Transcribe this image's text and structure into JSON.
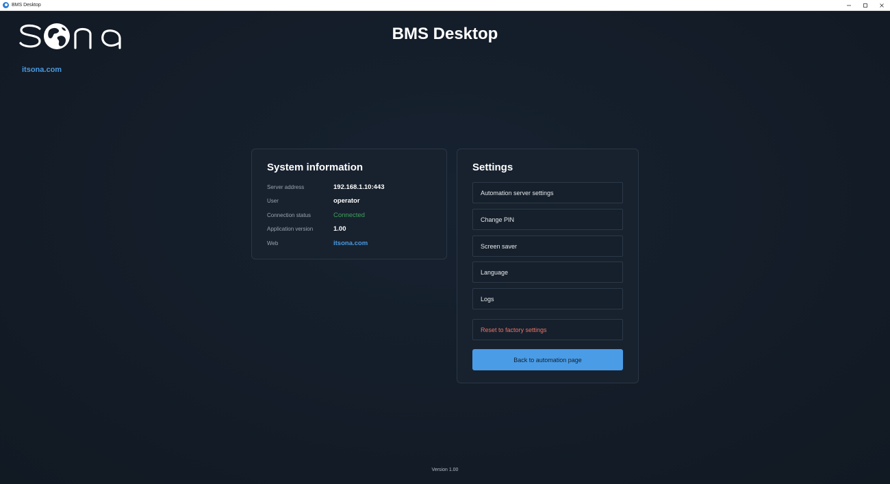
{
  "window": {
    "title": "BMS Desktop",
    "controls": [
      "minimize-icon",
      "maximize-icon",
      "close-icon"
    ]
  },
  "brand": {
    "logo_text": "SONA",
    "link": "itsona.com"
  },
  "app_title": "BMS Desktop",
  "system_info": {
    "title": "System information",
    "rows": [
      {
        "label": "Server address",
        "value": "192.168.1.10:443"
      },
      {
        "label": "User",
        "value": "operator"
      },
      {
        "label": "Connection status",
        "value": "Connected"
      },
      {
        "label": "Application version",
        "value": "1.00"
      },
      {
        "label": "Web",
        "value": "itsona.com"
      }
    ]
  },
  "settings": {
    "title": "Settings",
    "items": [
      "Automation server settings",
      "Change PIN",
      "Screen saver",
      "Language",
      "Logs"
    ],
    "reset_label": "Reset to factory settings",
    "back_label": "Back to automation page"
  },
  "footer": {
    "version": "Version 1.00"
  },
  "colors": {
    "background": "#141d28",
    "panel": "#18222f",
    "accent": "#4a9ce6",
    "link": "#4a9ae0",
    "success": "#3fa05a",
    "danger": "#e9756b"
  }
}
